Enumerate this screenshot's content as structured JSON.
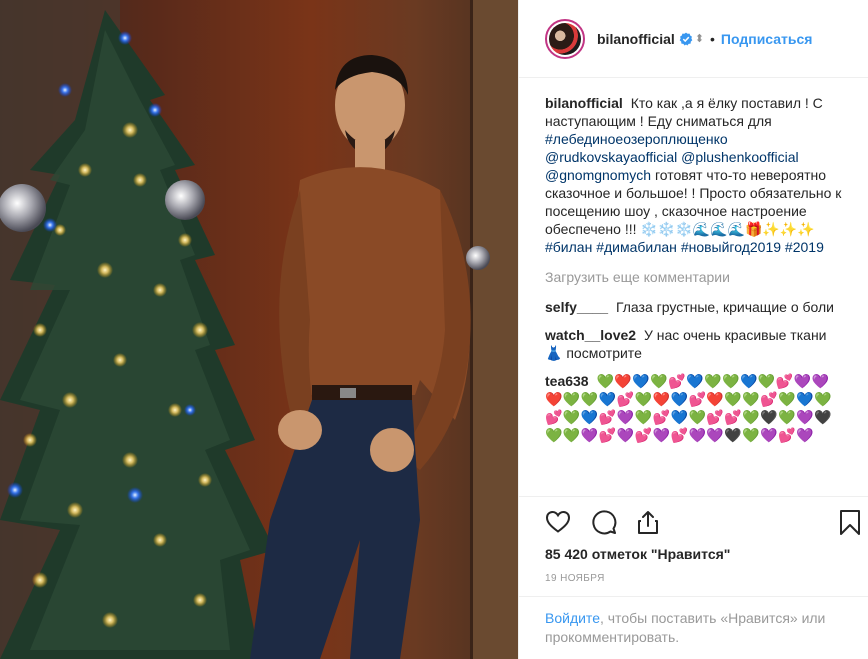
{
  "header": {
    "username": "bilanofficial",
    "separator": "•",
    "follow_label": "Подписаться"
  },
  "caption": {
    "user": "bilanofficial",
    "text1": "Кто как ,а я ёлку поставил ! С наступающим ! Еду сниматься для",
    "tag1": "#лебединоеозероплющенко",
    "mention1": "@rudkovskayaofficial",
    "mention2": "@plushenkoofficial",
    "mention3": "@gnomgnomych",
    "text2": "готовят что-то невероятно сказочное и большое! ! Просто обязательно к посещению шоу , сказочное настроение обеспечено !!!",
    "emoji": "❄️❄️❄️🌊🌊🌊🎁✨✨✨",
    "tag2": "#билан",
    "tag3": "#димабилан",
    "tag4": "#новыйгод2019",
    "tag5": "#2019"
  },
  "load_more": "Загрузить еще комментарии",
  "comments": [
    {
      "user": "selfy____",
      "text": "Глаза грустные, кричащие о боли"
    },
    {
      "user": "watch__love2",
      "text": "У нас очень красивые ткани 👗 посмотрите"
    },
    {
      "user": "tea638",
      "text": "💚❤️💙💚💕💙💚💚💙💚💕💜💜❤️💚💚💙💕💚❤️💙💕❤️💚💚💕💚💙💚💕💚💙💕💜💚💕💙💚💕💕💚🖤💚💜🖤💚💚💜💕💜💕💜💕💜💜🖤💚💜💕💜"
    }
  ],
  "likes": "85 420 отметок \"Нравится\"",
  "date": "19 ноября",
  "login": {
    "link": "Войдите",
    "text": ", чтобы поставить «Нравится» или прокомментировать."
  },
  "icons": {
    "verified": "verified-badge-icon",
    "like": "heart-icon",
    "comment": "comment-icon",
    "share": "share-icon",
    "save": "bookmark-icon"
  },
  "colors": {
    "accent": "#3897f0",
    "hashtag": "#003569",
    "text": "#262626",
    "muted": "#999999"
  }
}
